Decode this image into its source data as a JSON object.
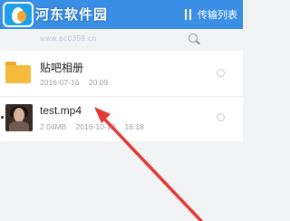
{
  "header": {
    "logo_title": "河东软件园",
    "logo_url": "www.pc0359.cn",
    "transfer_label": "传输列表"
  },
  "files": [
    {
      "name": "贴吧相册",
      "size": "",
      "date": "2016-07-16",
      "time": "20:09",
      "type": "folder"
    },
    {
      "name": "test.mp4",
      "size": "2.04MB",
      "date": "2016-10-19",
      "time": "16:18",
      "type": "video"
    }
  ],
  "colors": {
    "topbar": "#3a8ee6",
    "arrow": "#e23b35"
  },
  "icons": {
    "transfer": "transfer-icon",
    "search": "search-icon",
    "folder": "folder-icon",
    "video": "video-thumbnail"
  }
}
